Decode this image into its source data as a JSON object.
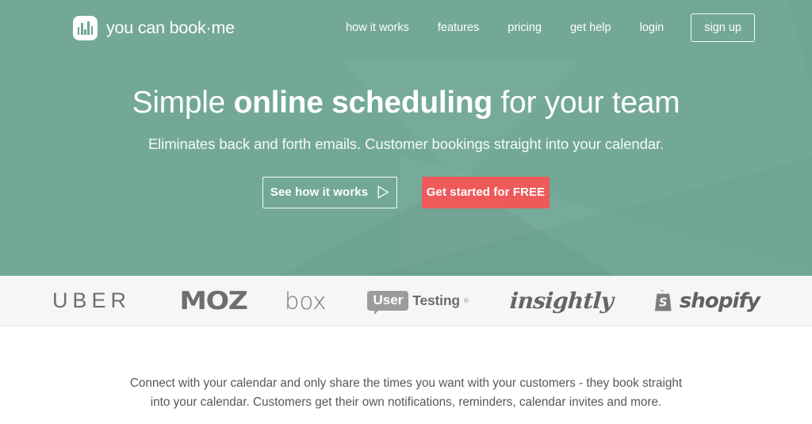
{
  "brand": {
    "name": "you can book·me",
    "logo_icon": "bar-chart-logo-icon",
    "accent_green": "#6ea594",
    "accent_red": "#ee5a5a"
  },
  "nav": {
    "items": [
      {
        "label": "how it works"
      },
      {
        "label": "features"
      },
      {
        "label": "pricing"
      },
      {
        "label": "get help"
      },
      {
        "label": "login"
      }
    ],
    "signup_label": "sign up"
  },
  "hero": {
    "headline_pre": "Simple ",
    "headline_bold": "online scheduling",
    "headline_post": " for your team",
    "subhead": "Eliminates back and forth emails. Customer bookings straight into your calendar.",
    "cta_secondary": "See how it works",
    "cta_secondary_icon": "play-triangle-icon",
    "cta_primary": "Get started for FREE"
  },
  "logos": {
    "uber": "UBER",
    "moz": "MOZ",
    "box": "box",
    "usertesting_badge": "User",
    "usertesting_word": "Testing",
    "usertesting_mark": "®",
    "insightly": "insightly",
    "shopify": "shopify",
    "shopify_icon": "shopping-bag-icon"
  },
  "body": {
    "paragraph": "Connect with your calendar and only share the times you want with your customers - they book straight into your calendar. Customers get their own notifications, reminders, calendar invites and more."
  }
}
